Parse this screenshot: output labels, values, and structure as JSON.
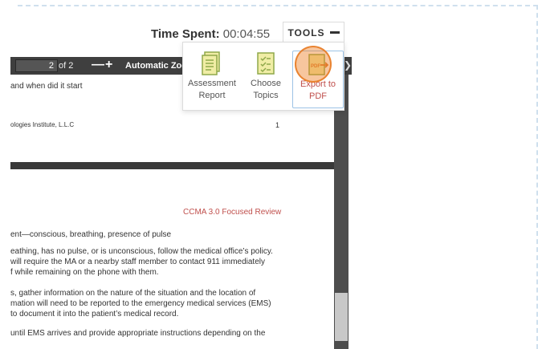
{
  "timer": {
    "label": "Time Spent:",
    "value": "00:04:55"
  },
  "tools": {
    "tab_label": "TOOLS",
    "items": [
      {
        "line1": "Assessment",
        "line2": "Report",
        "icon": "report-icon"
      },
      {
        "line1": "Choose",
        "line2": "Topics",
        "icon": "topics-icon"
      },
      {
        "line1": "Export to",
        "line2": "PDF",
        "icon": "pdf-export-icon"
      }
    ],
    "colors": {
      "icon_fill": "#f0eda5",
      "icon_stroke": "#8fa84a",
      "pdf_accent": "#d9772a"
    }
  },
  "viewer": {
    "page_number": "2",
    "page_total": "of 2",
    "zoom_out": "—",
    "zoom_in": "+",
    "zoom_level": "Automatic Zoom"
  },
  "document": {
    "page1_line": "and when did it start",
    "footer_left": "ologies Institute, L.L.C",
    "footer_right": "1",
    "review_title": "CCMA 3.0 Focused Review",
    "heading_line": "ent—conscious, breathing, presence of pulse",
    "para1": [
      "eathing, has no pulse, or is unconscious, follow the medical office’s policy.",
      "will require the MA or a nearby staff member to contact 911 immediately",
      "f while remaining on the phone with them."
    ],
    "para2": [
      "s, gather information on the nature of the situation and the location of",
      "mation will need to be reported to the emergency medical services (EMS)",
      "to document it into the patient’s medical record."
    ],
    "para3": [
      "until EMS arrives and provide appropriate instructions depending on the"
    ]
  }
}
